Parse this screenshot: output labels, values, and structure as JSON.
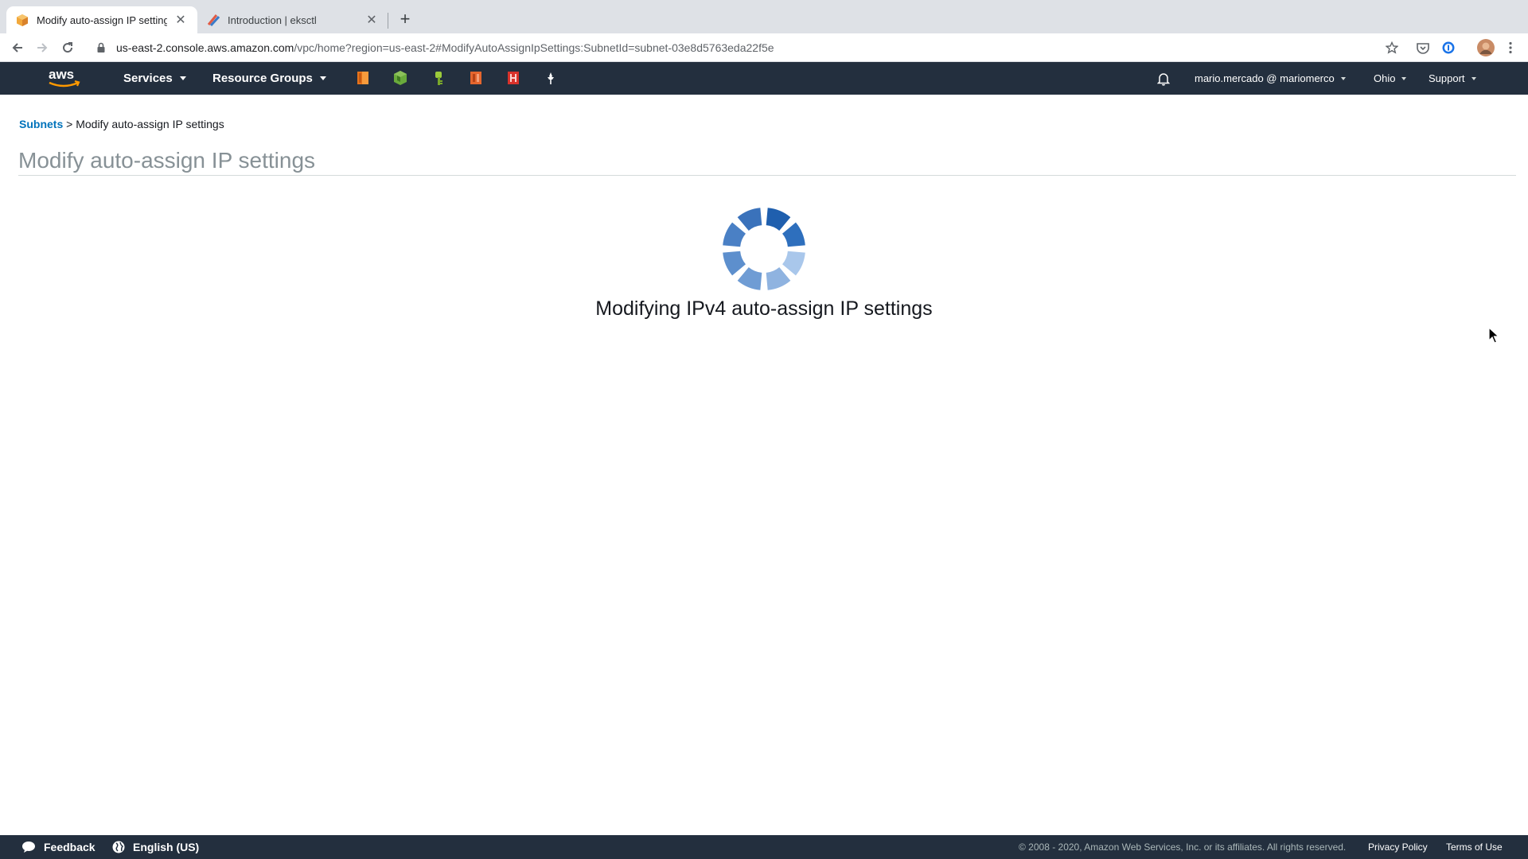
{
  "browser": {
    "tabs": [
      {
        "title": "Modify auto-assign IP settings |",
        "active": true,
        "favicon": "aws-cube-icon"
      },
      {
        "title": "Introduction | eksctl",
        "active": false,
        "favicon": "eksctl-icon"
      }
    ],
    "url_host": "us-east-2.console.aws.amazon.com",
    "url_path": "/vpc/home?region=us-east-2#ModifyAutoAssignIpSettings:SubnetId=subnet-03e8d5763eda22f5e"
  },
  "aws_nav": {
    "services_label": "Services",
    "resource_groups_label": "Resource Groups",
    "pinned": [
      "ec2-pin-icon",
      "eks-pin-icon",
      "iam-pin-icon",
      "cloudformation-pin-icon",
      "pin-5-icon",
      "pin-6-icon"
    ],
    "account_label": "mario.mercado @ mariomerco",
    "region_label": "Ohio",
    "support_label": "Support"
  },
  "breadcrumb": {
    "parent": "Subnets",
    "separator": ">",
    "current": "Modify auto-assign IP settings"
  },
  "page": {
    "title": "Modify auto-assign IP settings",
    "status_text": "Modifying IPv4 auto-assign IP settings"
  },
  "footer": {
    "feedback_label": "Feedback",
    "language_label": "English (US)",
    "copyright": "© 2008 - 2020, Amazon Web Services, Inc. or its affiliates. All rights reserved.",
    "privacy_label": "Privacy Policy",
    "terms_label": "Terms of Use"
  },
  "colors": {
    "aws_nav_bg": "#232f3e",
    "link_blue": "#0073bb",
    "spinner_blue": "#3a7bc8"
  }
}
